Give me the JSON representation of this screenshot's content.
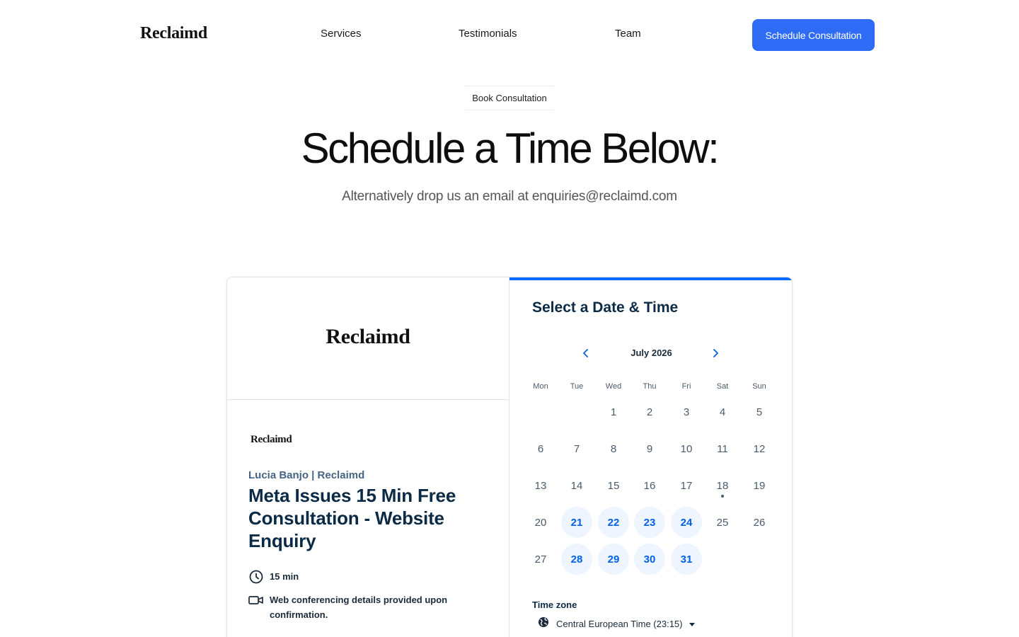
{
  "header": {
    "logo": "Reclaimd",
    "nav": [
      "Services",
      "Testimonials",
      "Team"
    ],
    "cta": "Schedule Consultation",
    "cta_color": "#2f6cf6"
  },
  "hero": {
    "eyebrow": "Book Consultation",
    "title": "Schedule a Time Below:",
    "subtitle": "Alternatively drop us an email at enquiries@reclaimd.com"
  },
  "booking": {
    "left": {
      "logo": "Reclaimd",
      "small_logo": "Reclaimd",
      "organizer": "Lucia Banjo | Reclaimd",
      "event_title": "Meta Issues 15 Min Free Consultation - Website Enquiry",
      "duration": "15 min",
      "duration_icon": "clock-icon",
      "conferencing": "Web conferencing details provided upon confirmation.",
      "conferencing_icon": "video-camera-icon"
    },
    "right": {
      "title": "Select a Date & Time",
      "month": "July 2026",
      "accent_color": "#0069ff",
      "weekdays": [
        "Mon",
        "Tue",
        "Wed",
        "Thu",
        "Fri",
        "Sat",
        "Sun"
      ],
      "first_weekday_index": 2,
      "days_in_month": 31,
      "available_days": [
        21,
        22,
        23,
        24,
        28,
        29,
        30,
        31
      ],
      "today": 18,
      "timezone_label": "Time zone",
      "timezone_value": "Central European Time (23:15)"
    }
  }
}
